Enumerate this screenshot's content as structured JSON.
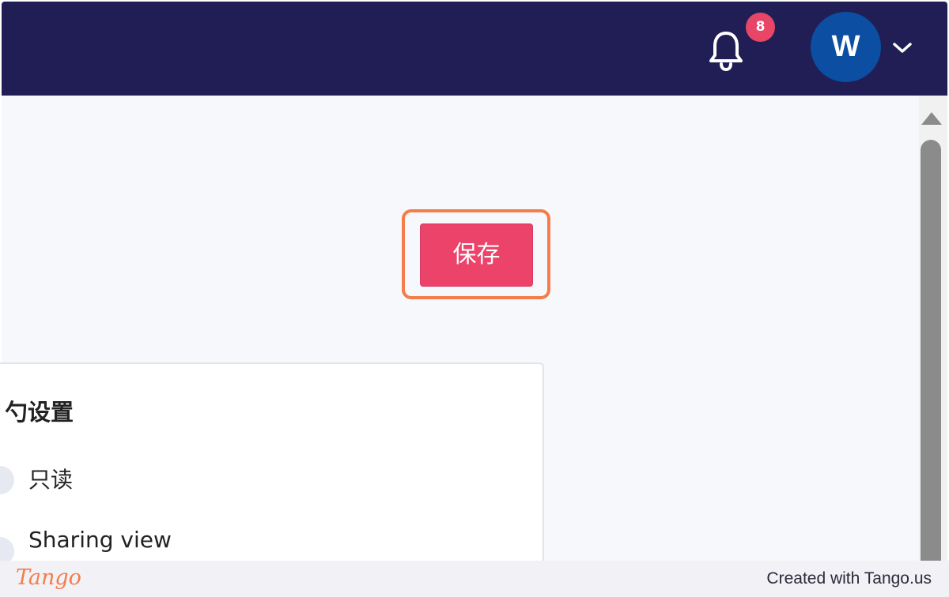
{
  "header": {
    "notification_count": "8",
    "avatar_initial": "W"
  },
  "main": {
    "save_label": "保存",
    "settings_card": {
      "title": "勺设置",
      "options": [
        {
          "label": "只读"
        },
        {
          "label": "Sharing view"
        }
      ]
    }
  },
  "footer": {
    "logo_text": "Tango",
    "credit": "Created with Tango.us"
  },
  "colors": {
    "header_bg": "#211e55",
    "save_button": "#ec436b",
    "highlight": "#f47d49",
    "badge": "#e84667",
    "avatar": "#0b4ea2"
  },
  "icons": {
    "bell": "bell-icon",
    "chevron": "chevron-down-icon",
    "scroll_up": "scroll-up-arrow-icon"
  }
}
